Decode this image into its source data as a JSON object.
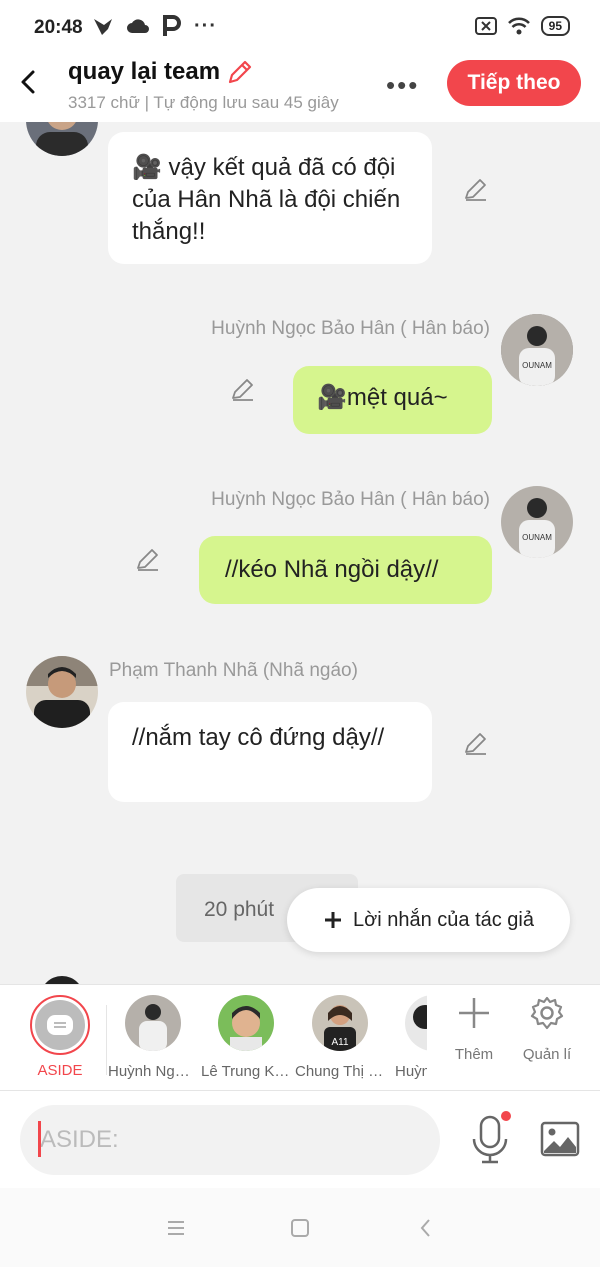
{
  "status_bar": {
    "time": "20:48",
    "notification_icons": [
      "fox-icon",
      "cloud-icon",
      "p-icon",
      "more-dots-icon"
    ],
    "battery": "95"
  },
  "header": {
    "title": "quay lại team",
    "subtitle": "3317 chữ | Tự động lưu sau 45 giây",
    "more_label": "•••",
    "next_label": "Tiếp theo"
  },
  "messages": [
    {
      "side": "left",
      "name": "",
      "text": "🎥 vậy kết quả đã có đội của Hân Nhã là đội chiến thắng!!"
    },
    {
      "side": "right",
      "name": "Huỳnh Ngọc Bảo Hân ( Hân báo)",
      "text": "🎥mệt quá~"
    },
    {
      "side": "right",
      "name": "Huỳnh Ngọc Bảo Hân ( Hân báo)",
      "text": "//kéo Nhã ngồi dậy//"
    },
    {
      "side": "left",
      "name": "Phạm Thanh Nhã (Nhã ngáo)",
      "text": "//nắm tay cô đứng dậy//"
    }
  ],
  "timestamp": "20 phút",
  "author_note": {
    "label": "Lời nhắn của tác giả"
  },
  "characters": {
    "aside_label": "ASIDE",
    "list": [
      {
        "label": "Huỳnh Ngọc Bảo Hân"
      },
      {
        "label": "Lê Trung Kiên"
      },
      {
        "label": "Chung Thị Hà"
      },
      {
        "label": "Huỳnh"
      }
    ],
    "add_label": "Thêm",
    "manage_label": "Quản lí"
  },
  "input": {
    "placeholder": "ASIDE:"
  },
  "colors": {
    "accent": "#f2464c",
    "bubble_green": "#d6f58e",
    "background": "#f2f2f2"
  }
}
